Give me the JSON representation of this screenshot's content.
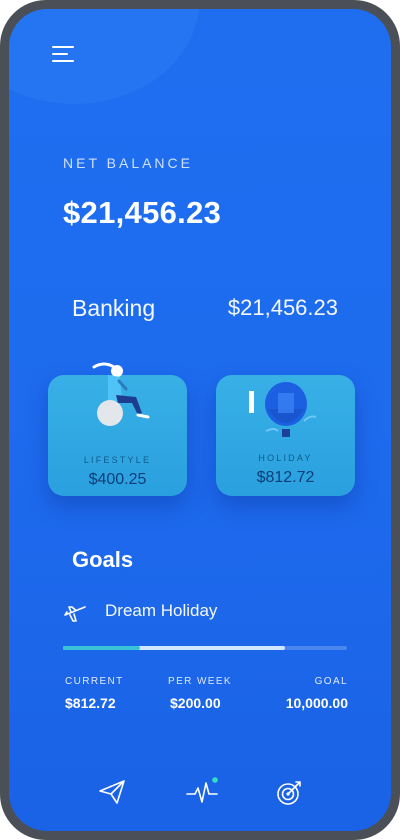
{
  "header": {
    "net_balance_label": "NET BALANCE",
    "net_balance_value": "$21,456.23"
  },
  "banking": {
    "label": "Banking",
    "value": "$21,456.23"
  },
  "categories": [
    {
      "label": "LIFESTYLE",
      "amount": "$400.25",
      "icon": "person-on-ball-illustration"
    },
    {
      "label": "HOLIDAY",
      "amount": "$812.72",
      "icon": "hot-air-balloon-illustration"
    }
  ],
  "goals": {
    "title": "Goals",
    "goal_name": "Dream Holiday",
    "goal_icon": "airplane-icon",
    "progress": {
      "current_fraction": 0.27,
      "projected_fraction": 0.78,
      "current_color": "#38c4d6",
      "projected_color": "#cfe7ff"
    },
    "stats": {
      "current_label": "CURRENT",
      "current_value": "$812.72",
      "per_week_label": "PER WEEK",
      "per_week_value": "$200.00",
      "goal_label": "GOAL",
      "goal_value": "10,000.00"
    }
  },
  "bottom_nav": [
    {
      "name": "send",
      "icon": "paper-plane-icon"
    },
    {
      "name": "activity",
      "icon": "pulse-icon",
      "badge_color": "#2fe0c4"
    },
    {
      "name": "goals",
      "icon": "target-icon"
    }
  ],
  "colors": {
    "background": "#1f6ef0",
    "card": "#38b0e6",
    "accent": "#2fe0c4"
  }
}
